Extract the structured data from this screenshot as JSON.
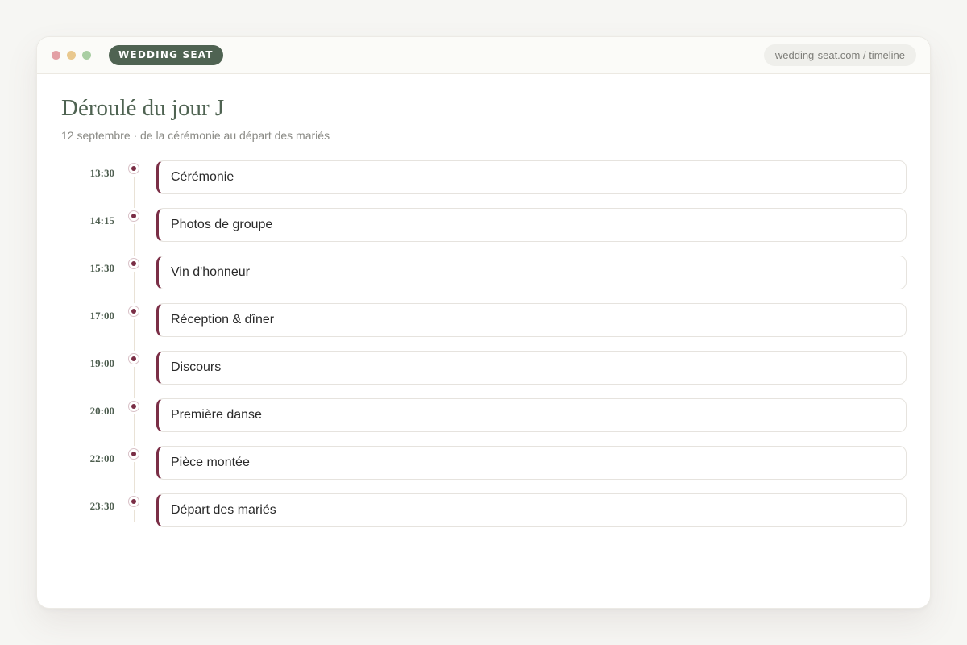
{
  "window": {
    "brand_label": "WEDDING SEAT",
    "url": "wedding-seat.com / timeline"
  },
  "page": {
    "title": "Déroulé du jour J",
    "subtitle": "12 septembre · de la cérémonie au départ des mariés"
  },
  "timeline": {
    "events": [
      {
        "time": "13:30",
        "label": "Cérémonie"
      },
      {
        "time": "14:15",
        "label": "Photos de groupe"
      },
      {
        "time": "15:30",
        "label": "Vin d'honneur"
      },
      {
        "time": "17:00",
        "label": "Réception & dîner"
      },
      {
        "time": "19:00",
        "label": "Discours"
      },
      {
        "time": "20:00",
        "label": "Première danse"
      },
      {
        "time": "22:00",
        "label": "Pièce montée"
      },
      {
        "time": "23:30",
        "label": "Départ des mariés"
      }
    ]
  },
  "colors": {
    "brand_green": "#4f6352",
    "accent_burgundy": "#7a2e46",
    "background": "#f6f6f3"
  }
}
